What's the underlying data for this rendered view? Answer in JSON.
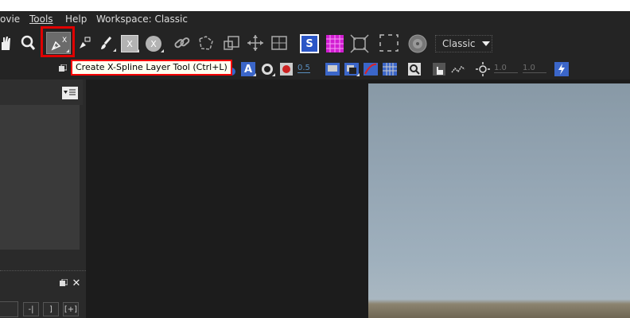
{
  "menu": {
    "items": [
      {
        "label": "ovie"
      },
      {
        "label": "Tools"
      },
      {
        "label": "Help"
      }
    ],
    "workspace_label": "Workspace: Classic"
  },
  "toolbar": {
    "tools": [
      {
        "name": "hand-tool",
        "icon": "hand-icon"
      },
      {
        "name": "zoom-tool",
        "icon": "magnifier-icon"
      },
      {
        "name": "create-xspline-tool",
        "icon": "xspline-pen-icon",
        "badge": "X"
      },
      {
        "name": "bspline-tool",
        "icon": "bspline-pen-icon"
      },
      {
        "name": "paint-brush-tool",
        "icon": "brush-icon"
      },
      {
        "name": "create-x-layer",
        "icon": "x-square-icon",
        "badge": "X"
      },
      {
        "name": "create-x-circle",
        "icon": "x-circle-icon",
        "badge": "X"
      },
      {
        "name": "link-tool",
        "icon": "link-icon"
      },
      {
        "name": "lasso-tool",
        "icon": "lasso-icon"
      },
      {
        "name": "scale-tool",
        "icon": "scale-icon"
      },
      {
        "name": "move-tool",
        "icon": "move-icon"
      },
      {
        "name": "shear-tool",
        "icon": "shear-icon"
      },
      {
        "name": "s-mode-toggle",
        "icon": "s-square-icon",
        "badge": "S"
      },
      {
        "name": "grid-toggle",
        "icon": "magenta-grid-icon"
      },
      {
        "name": "expand-tool",
        "icon": "expand-icon"
      },
      {
        "name": "corner-pin-tool",
        "icon": "corner-pin-icon"
      },
      {
        "name": "planar-tracker",
        "icon": "disc-icon"
      }
    ],
    "workspace_select": {
      "value": "Classic"
    }
  },
  "toolbar2": {
    "opacity_value": "0.5",
    "exposure_value": "1.0",
    "gamma_value": "1.0"
  },
  "tooltip": {
    "text": "Create X-Spline Layer Tool (Ctrl+L)"
  },
  "panel": {
    "bottom_buttons": [
      "-|",
      "]",
      "[+]"
    ]
  },
  "colors": {
    "accent_highlight": "#e00000",
    "tooltip_bg": "#fffff0",
    "active_blue": "#2b56c6",
    "grid_magenta": "#d21ed2"
  }
}
